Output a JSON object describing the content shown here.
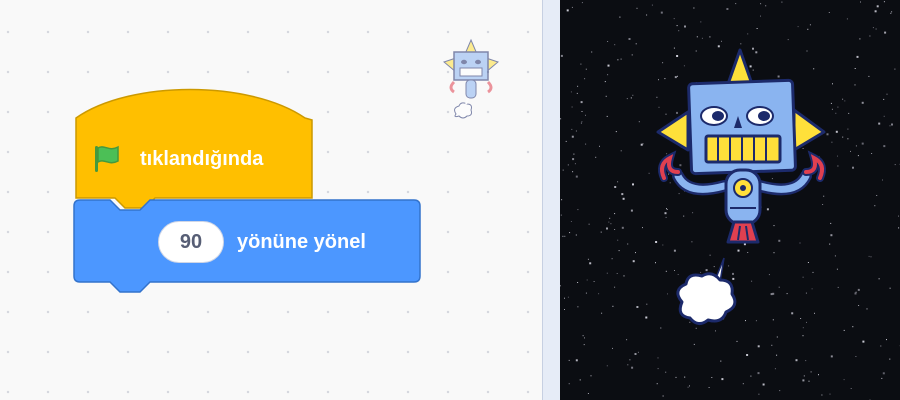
{
  "blocks": {
    "hat": {
      "label": "tıklandığında",
      "color": "#ffbf00",
      "border": "#cc9900",
      "icon": "green-flag-icon"
    },
    "motion": {
      "input_value": "90",
      "label": "yönüne yönel",
      "color": "#4c97ff",
      "border": "#3373cc"
    }
  },
  "colors": {
    "workspace": "#f9f9f9",
    "stage_background": "#0b0d12",
    "flag": "#4cbf56"
  },
  "sprite": {
    "name_icon": "robot-sprite"
  }
}
